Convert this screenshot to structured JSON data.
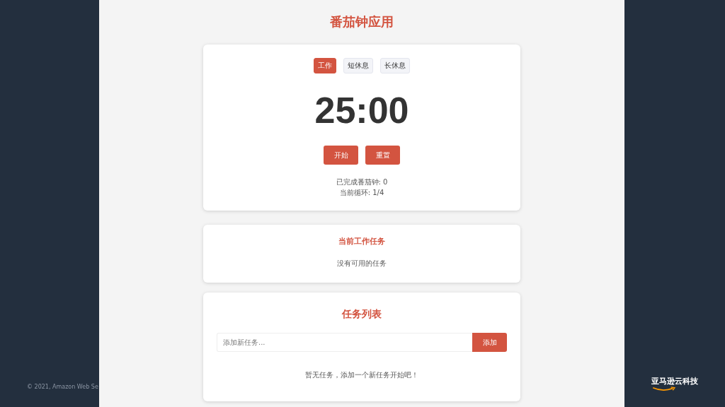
{
  "slide": {
    "copyright": "© 2021, Amazon Web Se",
    "logo": "亚马逊云科技"
  },
  "app": {
    "title": "番茄钟应用",
    "modes": [
      {
        "label": "工作",
        "selected": true
      },
      {
        "label": "短休息",
        "selected": false
      },
      {
        "label": "长休息",
        "selected": false
      }
    ],
    "timer": "25:00",
    "buttons": [
      "开始",
      "重置"
    ],
    "stats": [
      "已完成番茄钟: 0",
      "当前循环: 1/4"
    ],
    "current_task": {
      "heading": "当前工作任务",
      "empty_text": "没有可用的任务"
    },
    "task_list": {
      "heading": "任务列表",
      "input": {
        "placeholder": "添加新任务..."
      },
      "add_button": "添加",
      "empty_text": "暂无任务，添加一个新任务开始吧！"
    }
  }
}
